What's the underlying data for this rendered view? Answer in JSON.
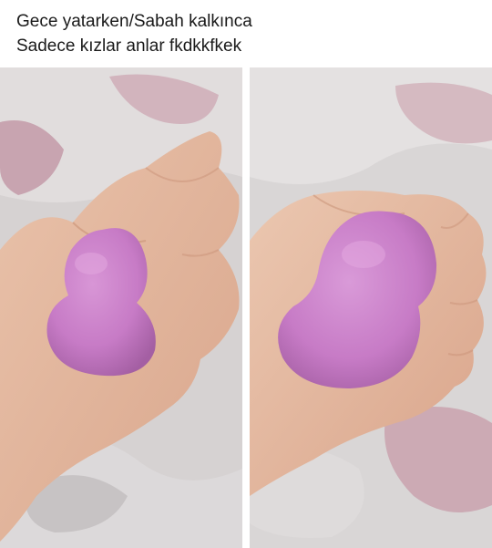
{
  "caption": {
    "line1": "Gece yatarken/Sabah kalkınca",
    "line2": "Sadece kızlar anlar fkdkkfkek"
  },
  "photos": [
    {
      "subject": "hand holding small pink makeup sponge",
      "background": "grey blanket with pink pattern"
    },
    {
      "subject": "hand holding large pink makeup sponge",
      "background": "grey blanket with pink pattern"
    }
  ],
  "colors": {
    "sponge": "#c77bc6",
    "skin": "#e3b59c",
    "blanket": "#d6d2d2",
    "blanket_pattern": "#c89aa8"
  }
}
